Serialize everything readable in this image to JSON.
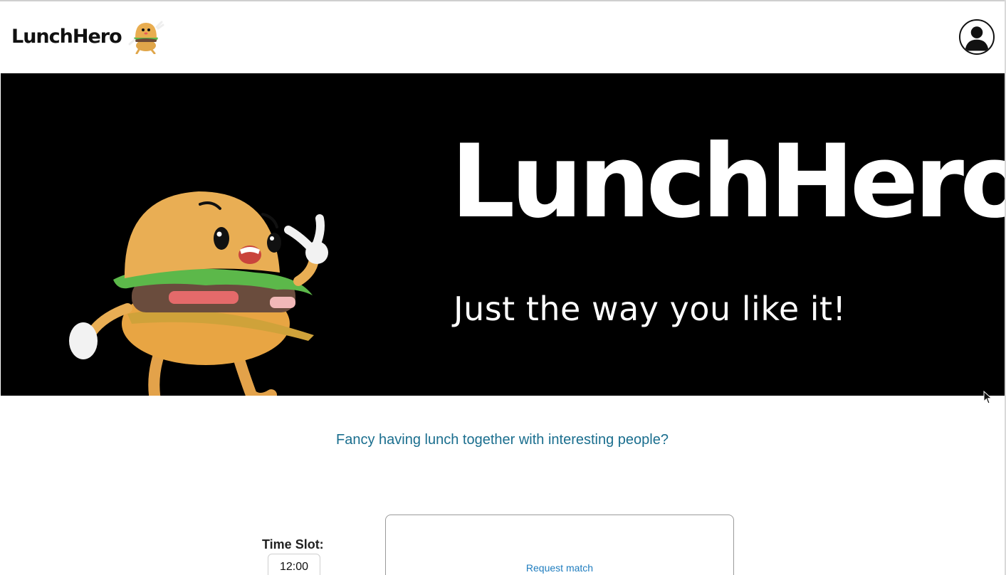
{
  "header": {
    "brand_name": "LunchHero",
    "brand_logo_icon": "burger-mascot-icon",
    "profile_icon": "user-avatar-icon"
  },
  "hero": {
    "mascot_icon": "burger-mascot-illustration",
    "title": "LunchHero",
    "tagline": "Just the way you like it!"
  },
  "main": {
    "prompt": "Fancy having lunch together with interesting people?",
    "time_slot": {
      "label": "Time Slot:",
      "value": "12:00"
    },
    "match_card": {
      "request_label": "Request match"
    }
  },
  "colors": {
    "accent_text": "#1a6e8e",
    "link": "#1f7dbf",
    "hero_bg": "#000000"
  }
}
